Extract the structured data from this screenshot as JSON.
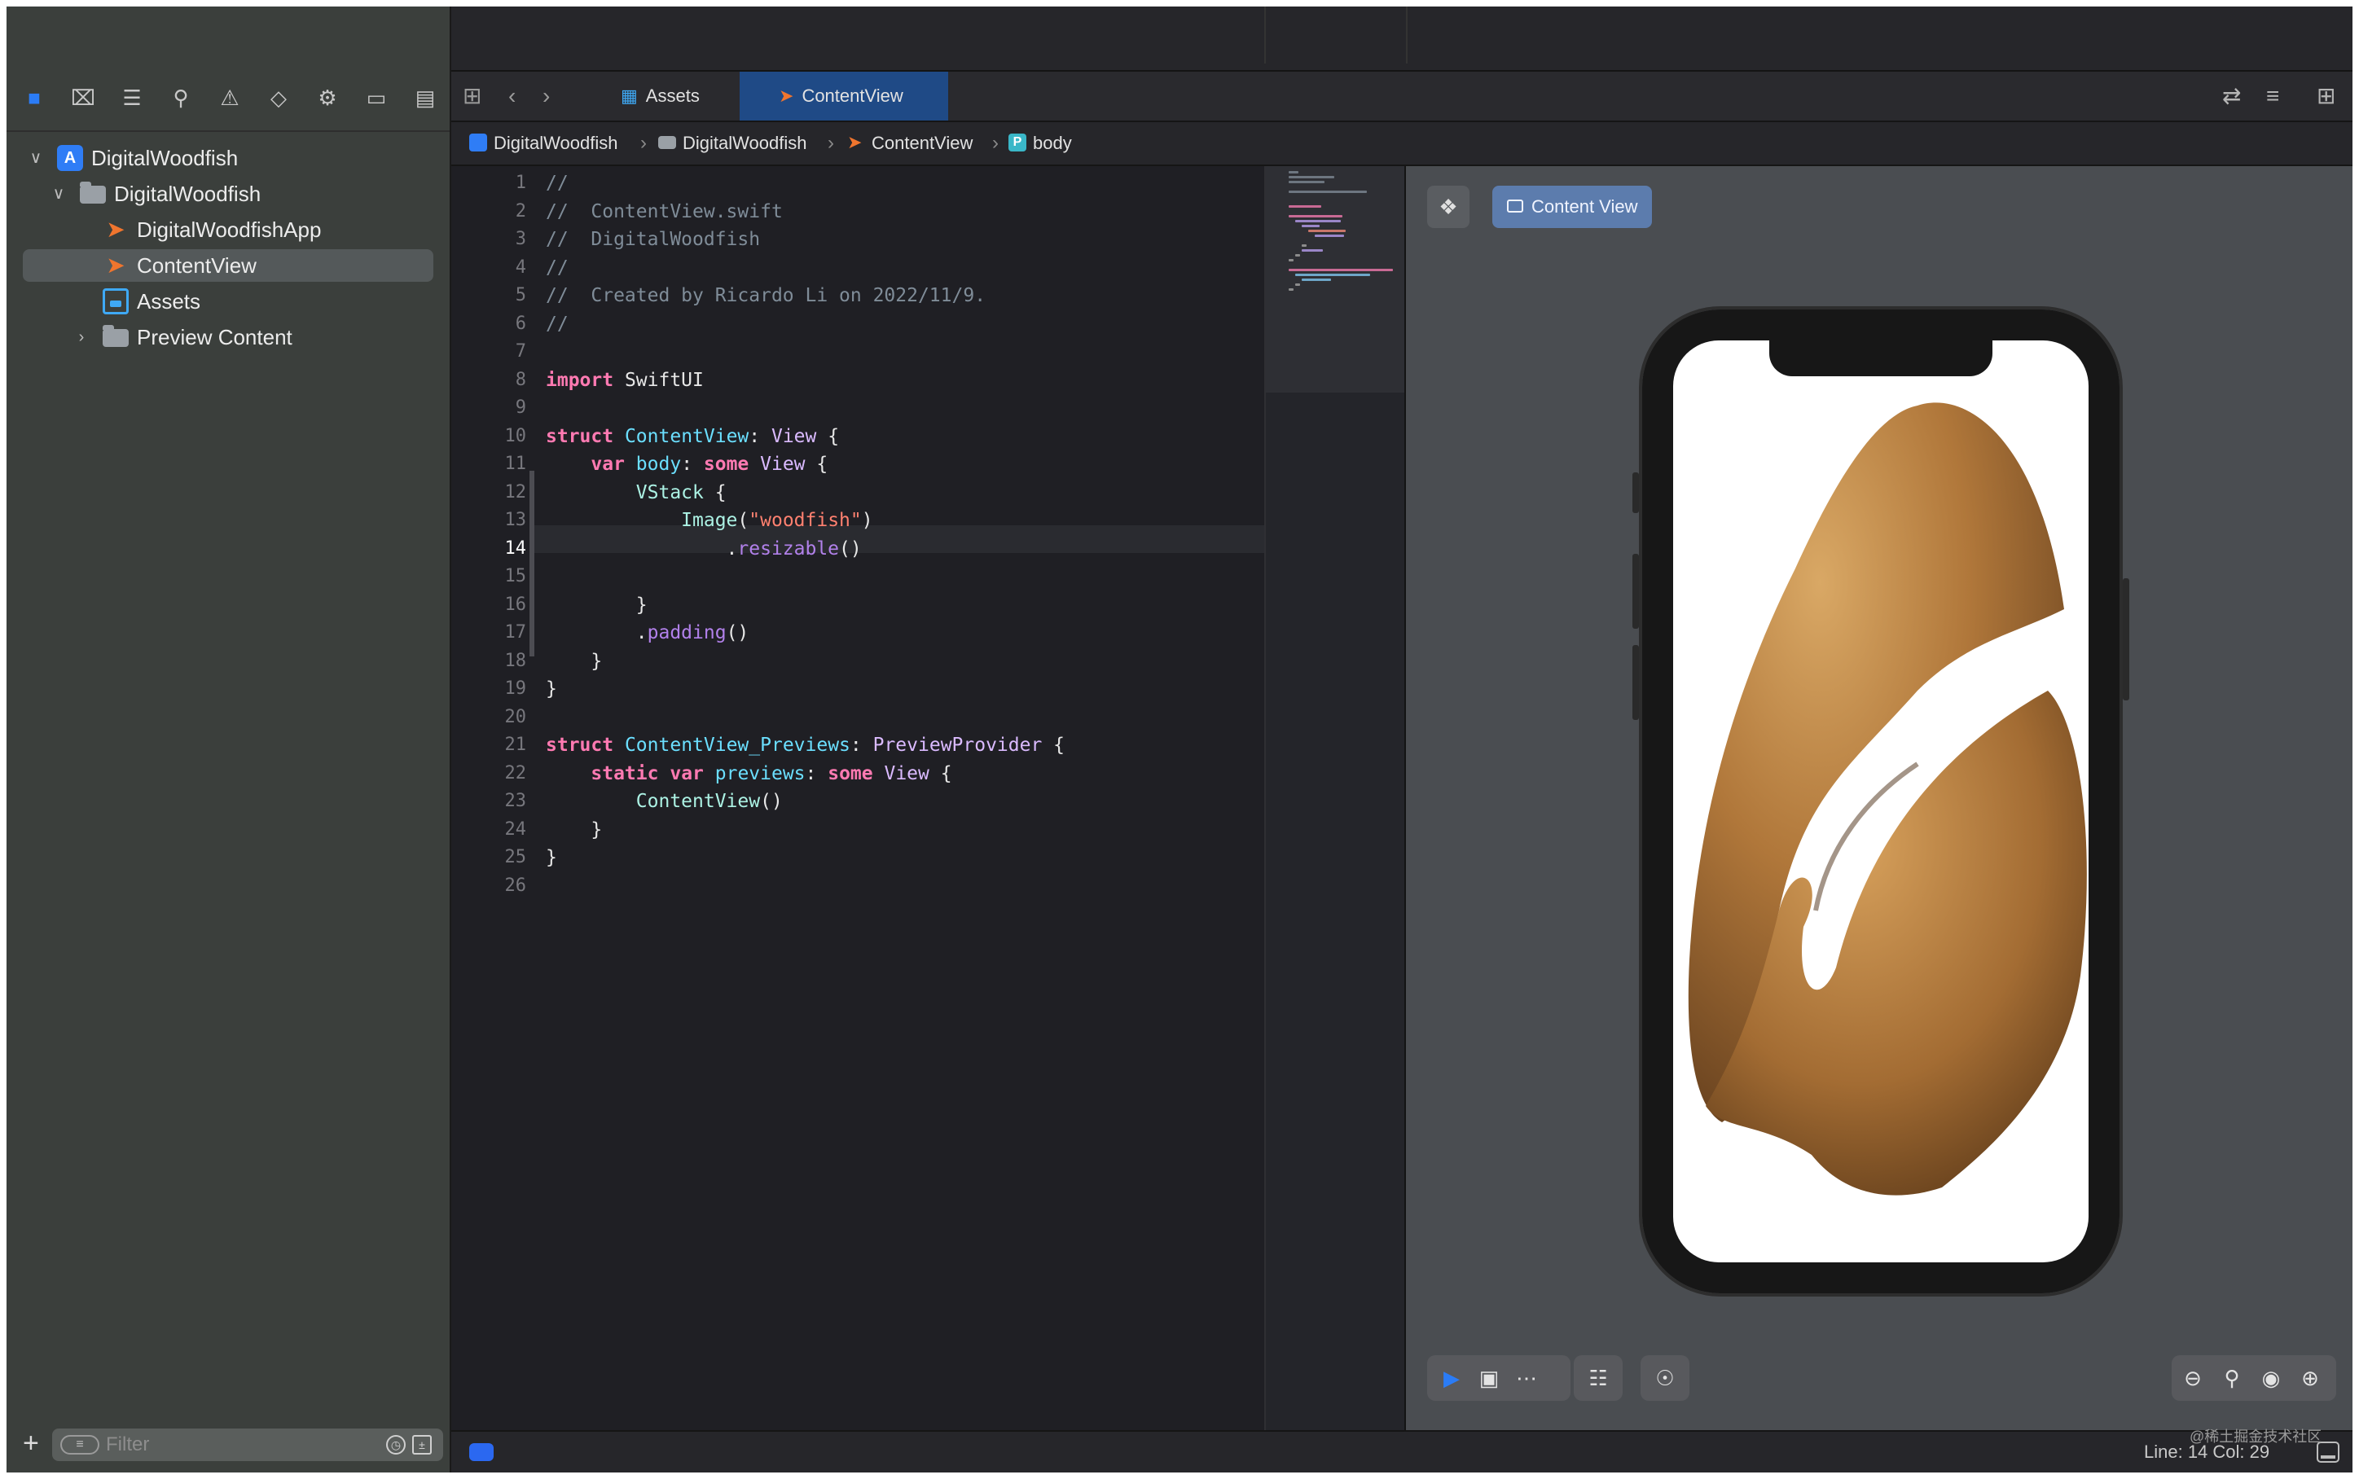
{
  "navigator": {
    "toolbar_icons": [
      "folder-icon",
      "source-control-icon",
      "hierarchy-icon",
      "search-icon",
      "warning-icon",
      "test-icon",
      "debug-icon",
      "breakpoint-icon",
      "report-icon"
    ],
    "tree": [
      {
        "label": "DigitalWoodfish",
        "type": "project",
        "expanded": true
      },
      {
        "label": "DigitalWoodfish",
        "type": "folder",
        "expanded": true
      },
      {
        "label": "DigitalWoodfishApp",
        "type": "swift-file"
      },
      {
        "label": "ContentView",
        "type": "swift-file",
        "selected": true
      },
      {
        "label": "Assets",
        "type": "asset-catalog"
      },
      {
        "label": "Preview Content",
        "type": "folder",
        "expanded": false
      }
    ],
    "filter_placeholder": "Filter"
  },
  "tabs": [
    {
      "label": "Assets",
      "active": false
    },
    {
      "label": "ContentView",
      "active": true
    }
  ],
  "breadcrumb": [
    "DigitalWoodfish",
    "DigitalWoodfish",
    "ContentView",
    "body"
  ],
  "breadcrumb_badge": "P",
  "editor": {
    "current_line": 14,
    "lines": [
      {
        "n": "1",
        "t": "//"
      },
      {
        "n": "2",
        "t": "//  ContentView.swift"
      },
      {
        "n": "3",
        "t": "//  DigitalWoodfish"
      },
      {
        "n": "4",
        "t": "//"
      },
      {
        "n": "5",
        "t": "//  Created by Ricardo Li on 2022/11/9."
      },
      {
        "n": "6",
        "t": "//"
      },
      {
        "n": "7",
        "t": ""
      },
      {
        "n": "8",
        "t": "import SwiftUI"
      },
      {
        "n": "9",
        "t": ""
      },
      {
        "n": "10",
        "t": "struct ContentView: View {"
      },
      {
        "n": "11",
        "t": "    var body: some View {"
      },
      {
        "n": "12",
        "t": "        VStack {"
      },
      {
        "n": "13",
        "t": "            Image(\"woodfish\")"
      },
      {
        "n": "14",
        "t": "                .resizable()"
      },
      {
        "n": "15",
        "t": ""
      },
      {
        "n": "16",
        "t": "        }"
      },
      {
        "n": "17",
        "t": "        .padding()"
      },
      {
        "n": "18",
        "t": "    }"
      },
      {
        "n": "19",
        "t": "}"
      },
      {
        "n": "20",
        "t": ""
      },
      {
        "n": "21",
        "t": "struct ContentView_Previews: PreviewProvider {"
      },
      {
        "n": "22",
        "t": "    static var previews: some View {"
      },
      {
        "n": "23",
        "t": "        ContentView()"
      },
      {
        "n": "24",
        "t": "    }"
      },
      {
        "n": "25",
        "t": "}"
      },
      {
        "n": "26",
        "t": ""
      }
    ]
  },
  "canvas": {
    "pin_label": "pin-icon",
    "preview_button": "Content View",
    "preview_image": "woodfish",
    "bottom_left_icons": [
      "live-preview-icon",
      "selectable-icon",
      "variants-icon",
      "device-settings-icon",
      "inspector-icon"
    ],
    "bottom_right_icons": [
      "zoom-out-icon",
      "zoom-fit-icon",
      "zoom-100-icon",
      "zoom-in-icon"
    ]
  },
  "status": {
    "line_col": "Line: 14  Col: 29",
    "watermark": "@稀土掘金技术社区"
  },
  "colors": {
    "keyword": "#ff7ab2",
    "type": "#dabaff",
    "declaration": "#6bdfff",
    "string": "#ff8170",
    "comment": "#7f8c98",
    "accent": "#2b7cf6"
  }
}
